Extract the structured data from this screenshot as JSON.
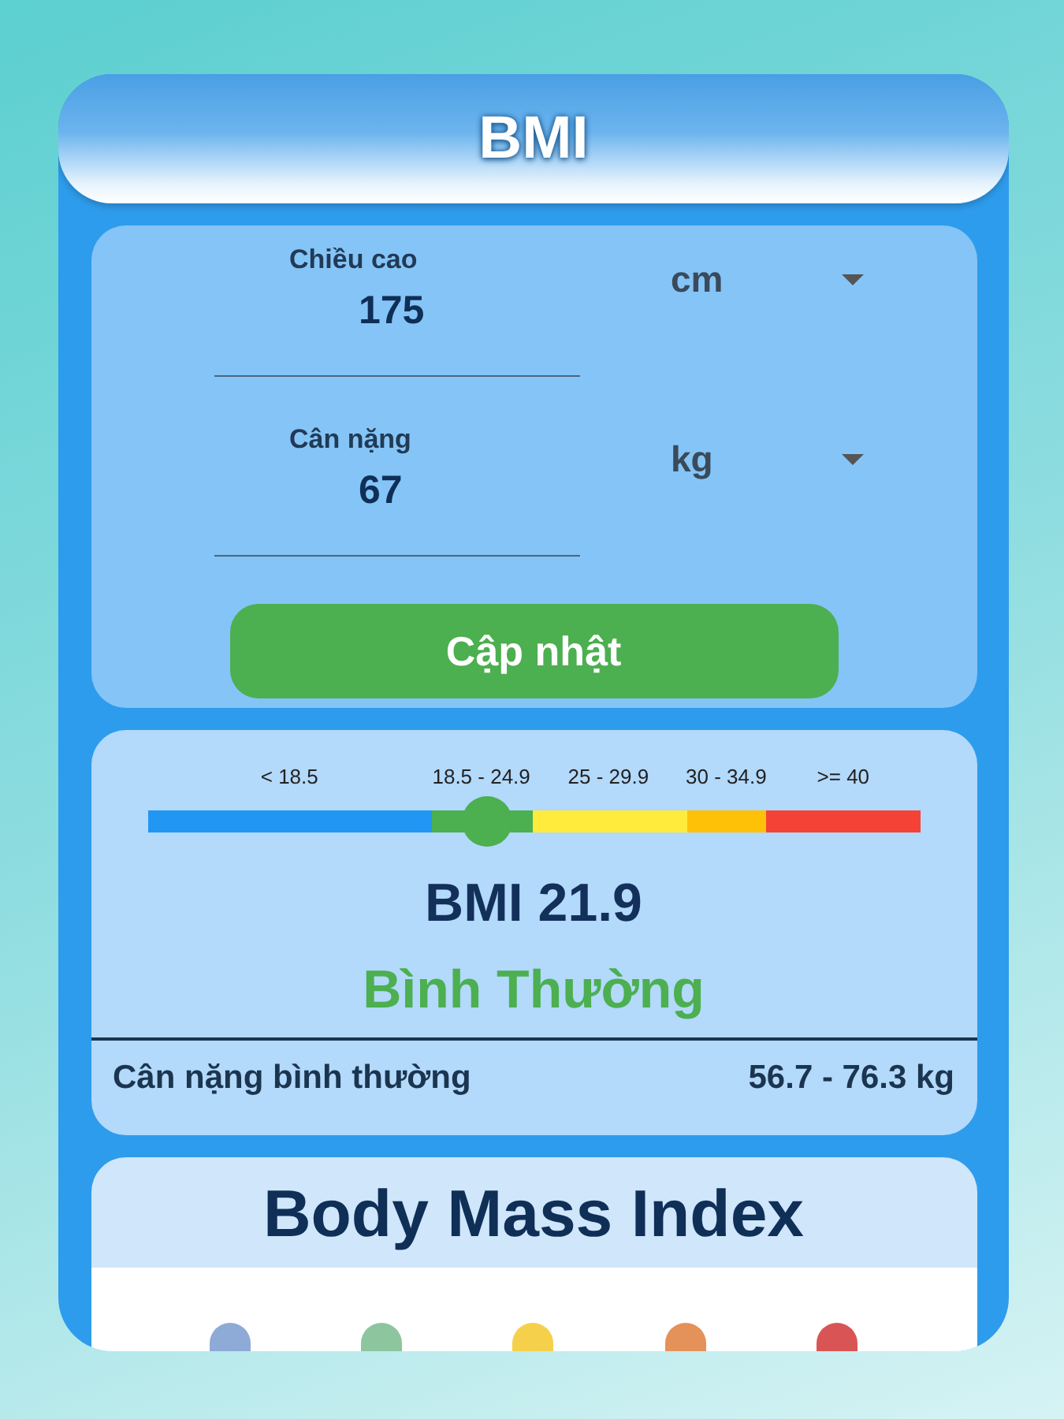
{
  "header": {
    "title": "BMI"
  },
  "inputs": [
    {
      "label": "Chiều cao",
      "value": "175",
      "unit": "cm"
    },
    {
      "label": "Cân nặng",
      "value": "67",
      "unit": "kg"
    }
  ],
  "update_button": {
    "label": "Cập nhật"
  },
  "scale": {
    "level": 0.44,
    "segments": [
      {
        "label": "< 18.5",
        "color": "#2196f3"
      },
      {
        "label": "18.5 - 24.9",
        "color": "#4caf50"
      },
      {
        "label": "25 - 29.9",
        "color": "#ffeb3b"
      },
      {
        "label": "30 - 34.9",
        "color": "#ffc107"
      },
      {
        "label": ">= 40",
        "color": "#f44336"
      }
    ]
  },
  "result": {
    "bmi": "BMI 21.9",
    "category": "Bình Thường",
    "normal_weight_label": "Cân nặng bình thường",
    "normal_weight_value": "56.7 - 76.3 kg"
  },
  "info_card": {
    "title": "Body Mass Index",
    "dots": [
      {
        "color": "#8eaad6"
      },
      {
        "color": "#8cc59e"
      },
      {
        "color": "#f5d04a"
      },
      {
        "color": "#e5915a"
      },
      {
        "color": "#d95555"
      }
    ]
  }
}
